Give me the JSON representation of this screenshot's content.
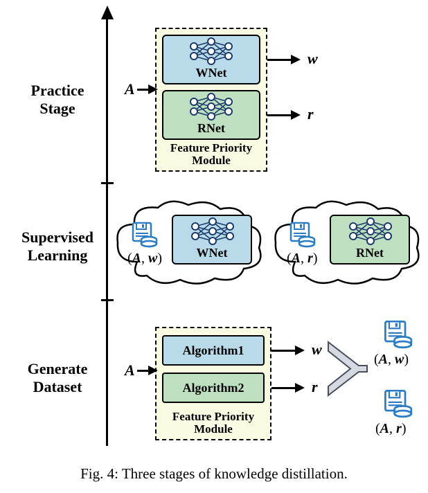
{
  "stages": {
    "practice": "Practice\nStage",
    "supervised": "Supervised\nLearning",
    "generate": "Generate\nDataset"
  },
  "fp_caption": "Feature Priority\nModule",
  "nets": {
    "wnet": "WNet",
    "rnet": "RNet"
  },
  "algos": {
    "algo1": "Algorithm1",
    "algo2": "Algorithm2"
  },
  "vars": {
    "A": "A",
    "w": "w",
    "r": "r"
  },
  "pairs": {
    "Aw": "(A, w)",
    "Ar": "(A, r)"
  },
  "caption": "Fig. 4: Three stages of knowledge distillation."
}
